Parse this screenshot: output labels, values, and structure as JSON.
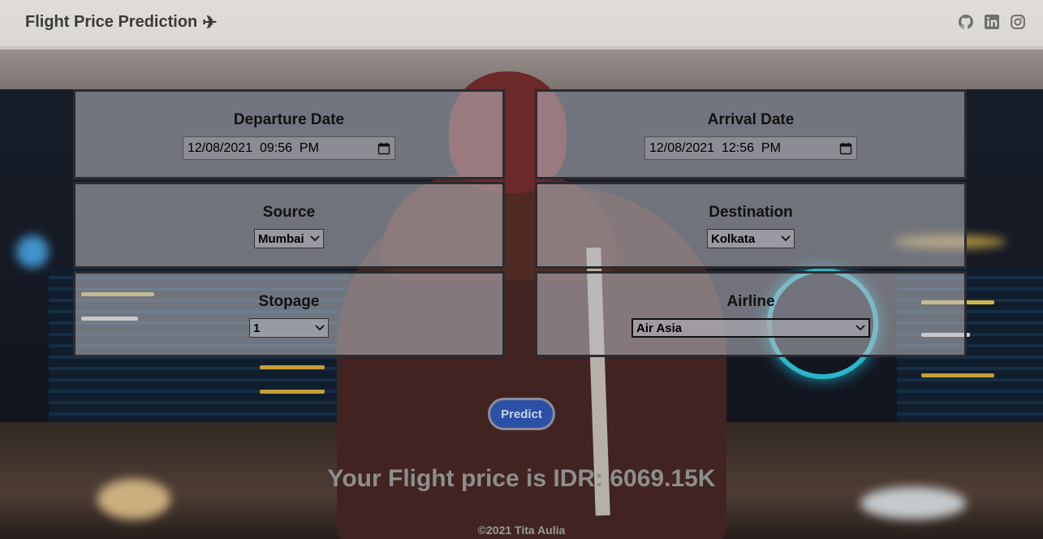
{
  "brand": {
    "title": "Flight Price Prediction",
    "icon": "airplane-icon"
  },
  "social": [
    "github-icon",
    "linkedin-icon",
    "instagram-icon"
  ],
  "form": {
    "departure": {
      "label": "Departure Date",
      "value": "12/08/2021  09:56  PM"
    },
    "arrival": {
      "label": "Arrival Date",
      "value": "12/08/2021  12:56  PM"
    },
    "source": {
      "label": "Source",
      "value": "Mumbai"
    },
    "destination": {
      "label": "Destination",
      "value": "Kolkata"
    },
    "stopage": {
      "label": "Stopage",
      "value": "1"
    },
    "airline": {
      "label": "Airline",
      "value": "Air Asia"
    }
  },
  "predict_label": "Predict",
  "result_text": "Your Flight price is IDR: 6069.15K",
  "footer_text": "©2021 Tita Aulia",
  "colors": {
    "predict_button": "#2b50a5",
    "navbar": "#e8e4e0"
  }
}
